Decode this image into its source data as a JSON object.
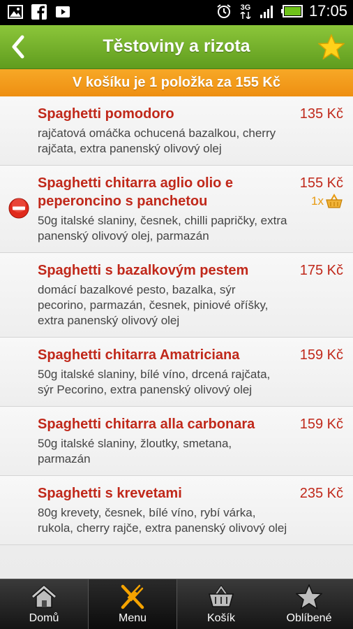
{
  "status_bar": {
    "time": "17:05",
    "network": "3G",
    "left_icons": [
      "gallery-icon",
      "facebook-icon",
      "youtube-icon"
    ],
    "right_icons": [
      "alarm-icon",
      "network-3g-icon",
      "signal-icon",
      "battery-icon"
    ]
  },
  "header": {
    "title": "Těstoviny a rizota",
    "back_icon": "back-chevron-icon",
    "favorite_icon": "star-icon"
  },
  "cart_banner": {
    "text": "V košíku je 1 položka za 155 Kč"
  },
  "items": [
    {
      "name": "Spaghetti pomodoro",
      "price": "135 Kč",
      "description": "rajčatová omáčka ochucená bazalkou, cherry rajčata, extra panenský olivový olej"
    },
    {
      "name": "Spaghetti chitarra aglio olio e peperoncino s panchetou",
      "price": "155 Kč",
      "description": "50g italské slaniny, česnek, chilli papričky, extra panenský olivový olej, parmazán",
      "quantity": "1x"
    },
    {
      "name": "Spaghetti s bazalkovým pestem",
      "price": "175 Kč",
      "description": "domácí bazalkové pesto, bazalka, sýr pecorino, parmazán, česnek, piniové oříšky, extra panenský olivový olej"
    },
    {
      "name": "Spaghetti chitarra Amatriciana",
      "price": "159 Kč",
      "description": "50g italské slaniny, bílé víno, drcená rajčata, sýr Pecorino, extra panenský olivový olej"
    },
    {
      "name": "Spaghetti chitarra alla carbonara",
      "price": "159 Kč",
      "description": "50g italské slaniny, žloutky, smetana, parmazán"
    },
    {
      "name": "Spaghetti s krevetami",
      "price": "235 Kč",
      "description": "80g krevety, česnek, bílé víno, rybí várka, rukola, cherry rajče, extra panenský olivový olej"
    }
  ],
  "bottom_nav": [
    {
      "label": "Domů",
      "icon": "home-icon"
    },
    {
      "label": "Menu",
      "icon": "cutlery-icon"
    },
    {
      "label": "Košík",
      "icon": "basket-icon"
    },
    {
      "label": "Oblíbené",
      "icon": "star-icon"
    }
  ],
  "colors": {
    "header_green": "#6fae28",
    "banner_orange": "#f29a1a",
    "item_red": "#c0281a",
    "qty_orange": "#e89a10"
  }
}
